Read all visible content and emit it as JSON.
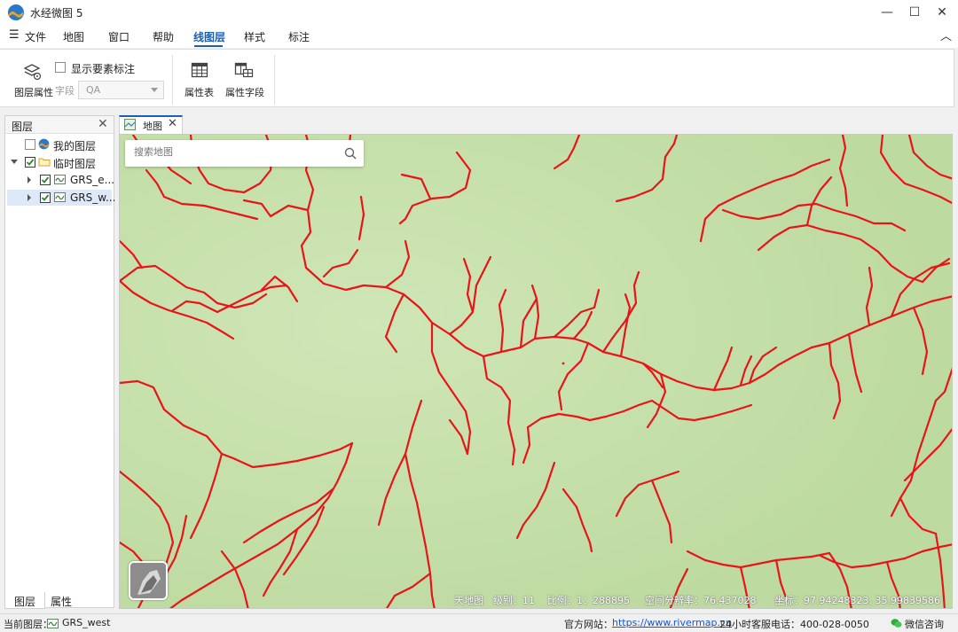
{
  "app": {
    "title": "水经微图 5"
  },
  "menu": {
    "items": [
      "文件",
      "地图",
      "窗口",
      "帮助",
      "线图层",
      "样式",
      "标注"
    ],
    "active": "线图层"
  },
  "ribbon": {
    "layer_props": "图层属性",
    "show_labels": "显示要素标注",
    "field_label": "字段",
    "field_value": "QA",
    "attr_table": "属性表",
    "attr_fields": "属性字段"
  },
  "layers": {
    "title": "图层",
    "items": [
      {
        "label": "我的图层",
        "checked": false
      },
      {
        "label": "临时图层",
        "checked": true
      },
      {
        "label": "GRS_e...",
        "checked": true
      },
      {
        "label": "GRS_w...",
        "checked": true
      }
    ],
    "tabs": [
      "图层",
      "属性"
    ]
  },
  "map": {
    "tab_title": "地图",
    "search_placeholder": "搜索地图",
    "info": {
      "source": "天地图",
      "level": "级别：11",
      "scale": "比例：1：288895",
      "resolution": "空间分辨率：76.437028",
      "coords": "坐标：97.94248323, 35.99839586"
    },
    "colors": {
      "background": "#c6e0ab",
      "river": "#e8141a"
    }
  },
  "status": {
    "current_layer_label": "当前图层：",
    "current_layer": "GRS_west",
    "website_label": "官方网站：",
    "website": "https://www.rivermap.cn",
    "hotline": "24小时客服电话：400-028-0050",
    "consult": "微信咨询"
  }
}
